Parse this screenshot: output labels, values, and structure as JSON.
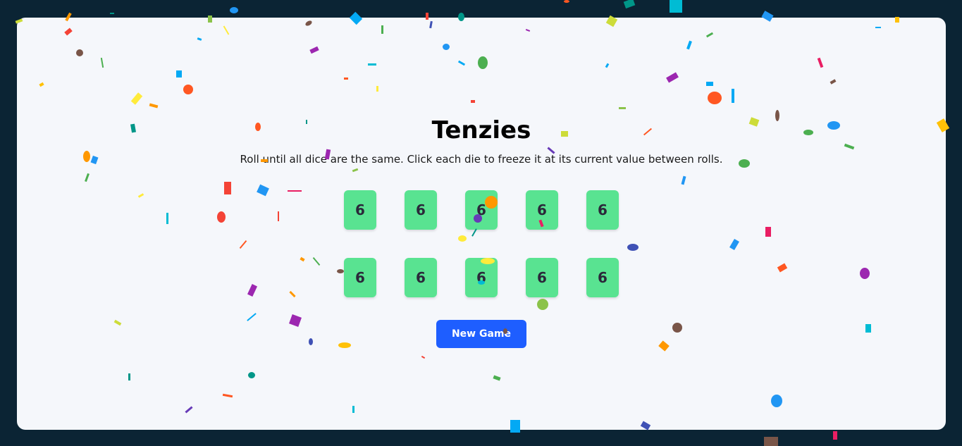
{
  "game": {
    "title": "Tenzies",
    "instructions": "Roll until all dice are the same. Click each die to freeze it at its current value between rolls.",
    "dice": [
      "6",
      "6",
      "6",
      "6",
      "6",
      "6",
      "6",
      "6",
      "6",
      "6"
    ],
    "button_label": "New Game"
  },
  "colors": {
    "background": "#0b2434",
    "card": "#f5f7fb",
    "die": "#59e391",
    "button": "#1e5eff"
  }
}
